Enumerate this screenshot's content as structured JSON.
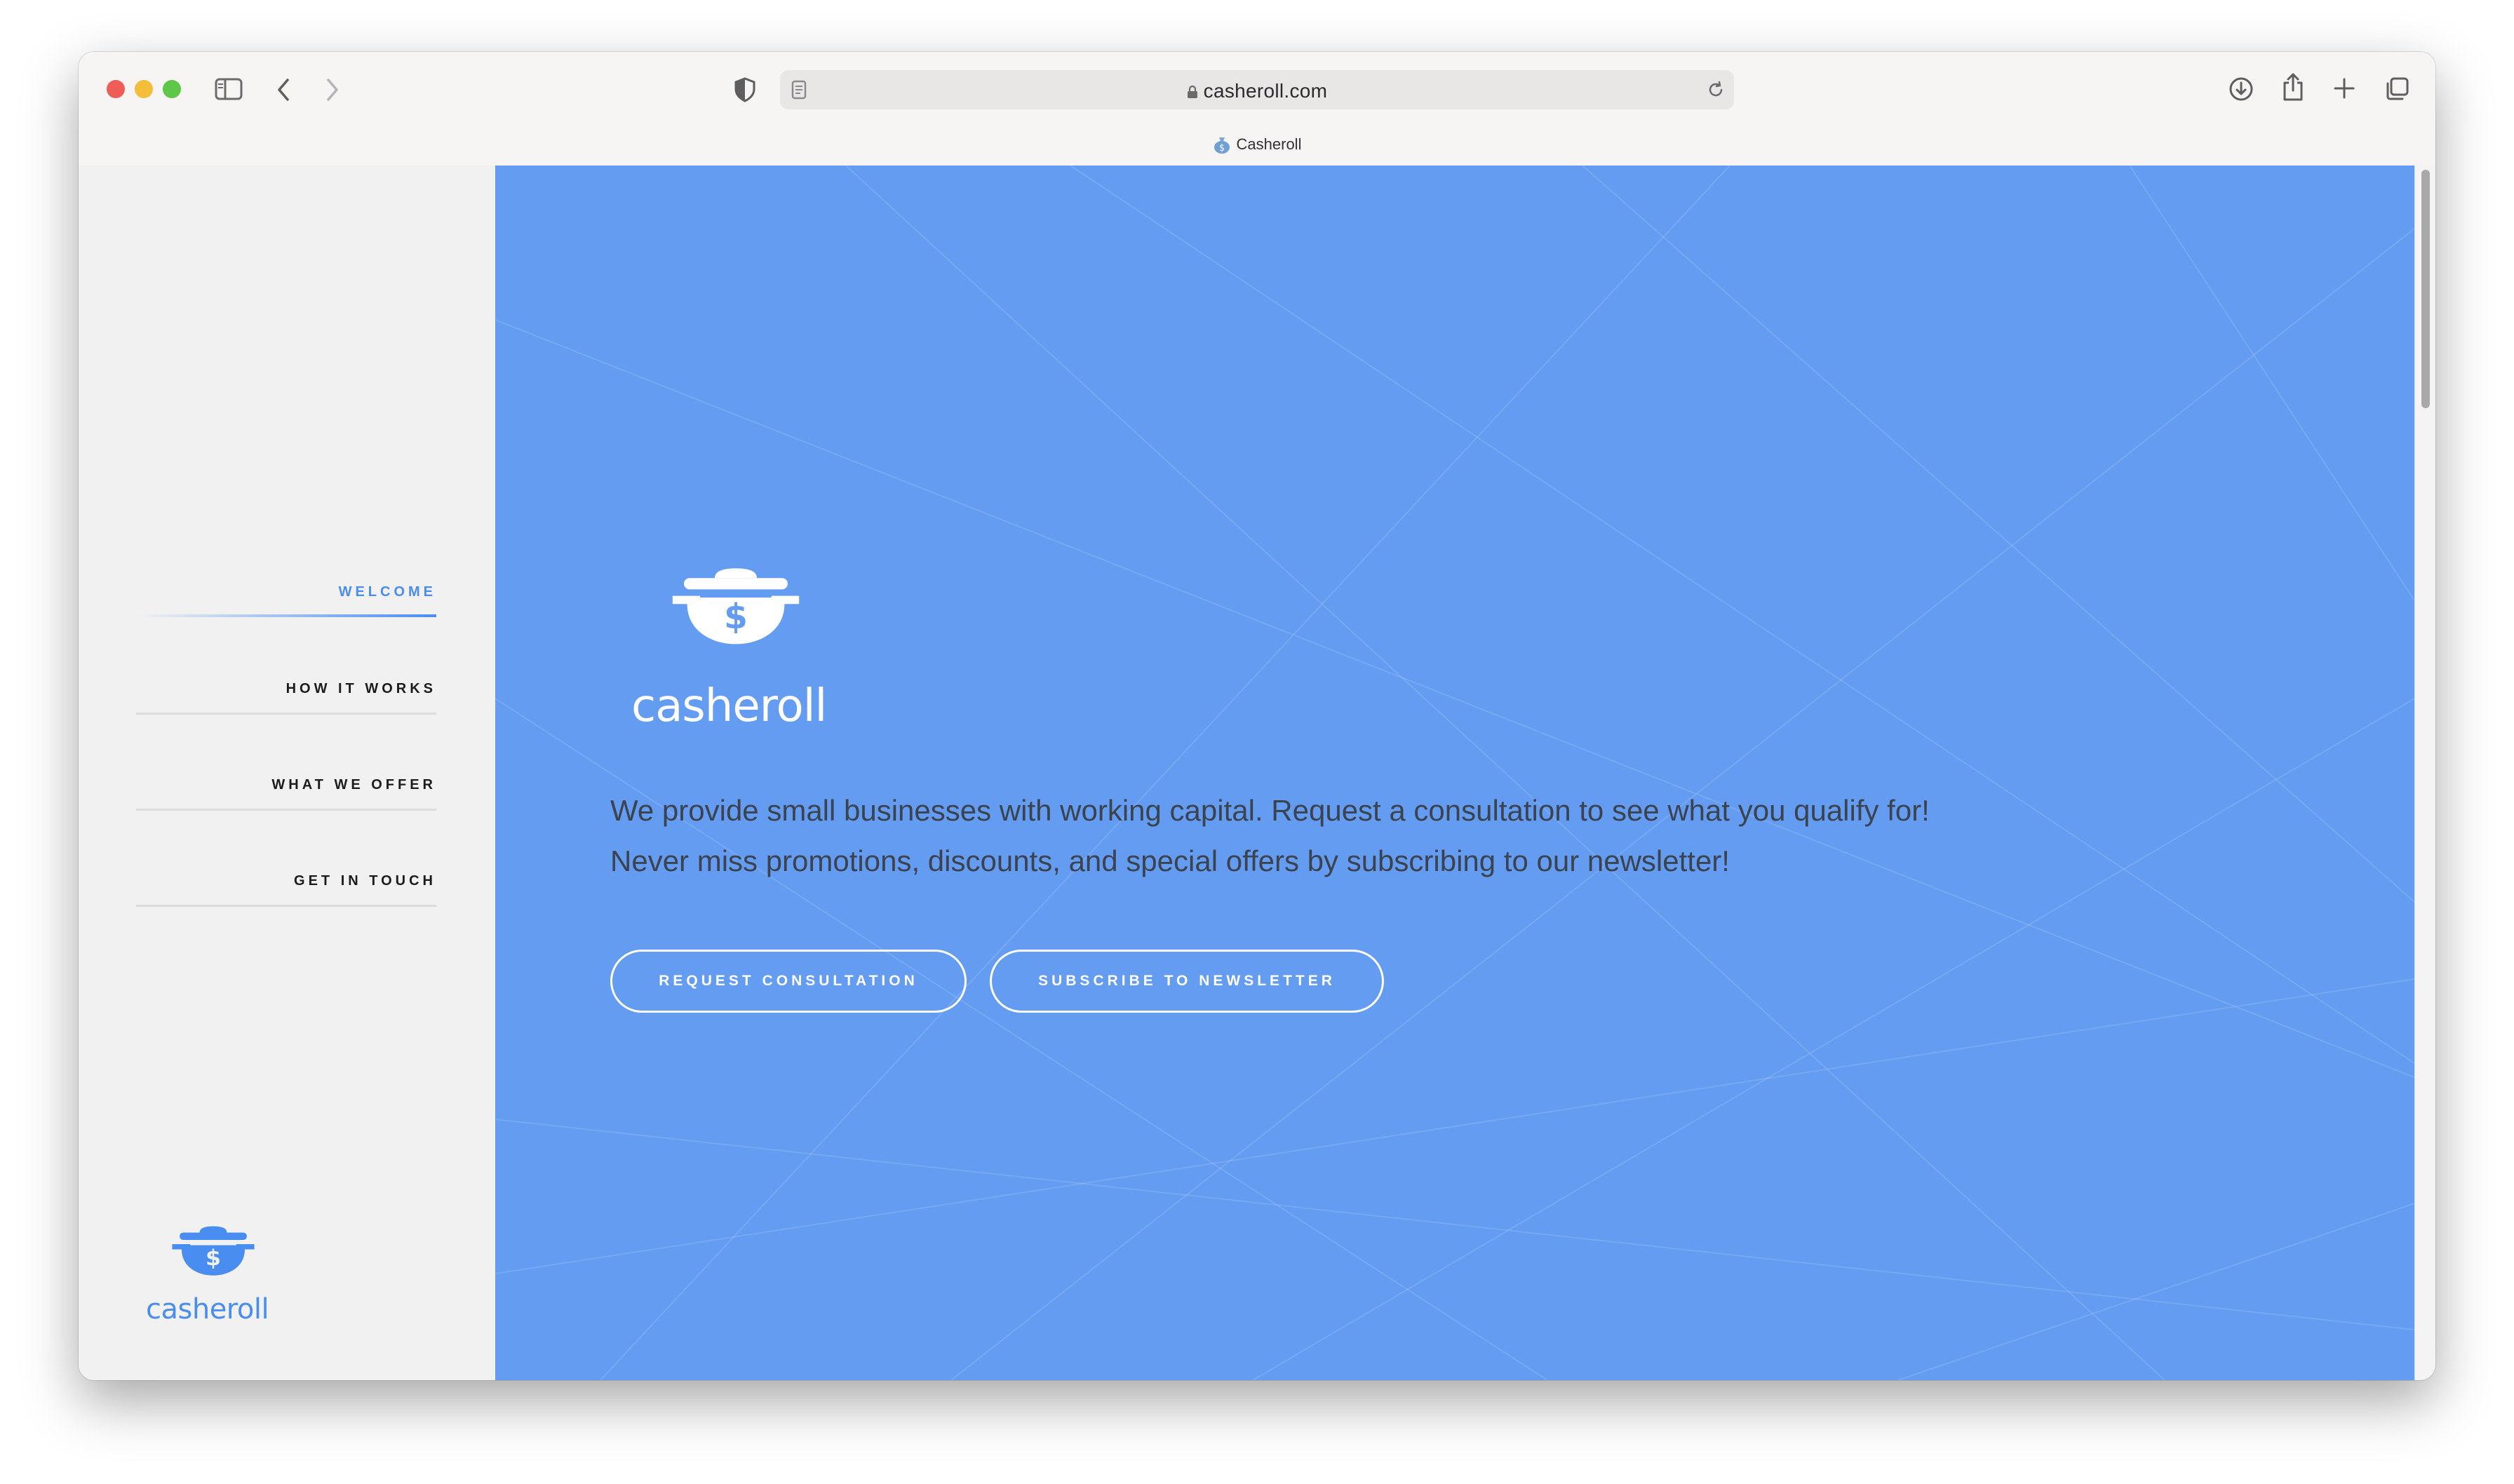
{
  "browser": {
    "url": "casheroll.com",
    "tab_title": "Casheroll"
  },
  "sidebar": {
    "nav": [
      {
        "label": "WELCOME",
        "active": true
      },
      {
        "label": "HOW IT WORKS",
        "active": false
      },
      {
        "label": "WHAT WE OFFER",
        "active": false
      },
      {
        "label": "GET IN TOUCH",
        "active": false
      }
    ],
    "logo_text": "casheroll"
  },
  "hero": {
    "logo_text": "casheroll",
    "line1": "We provide small businesses with working capital. Request a consultation to see what you qualify for!",
    "line2": "Never miss promotions, discounts, and special offers by subscribing to our newsletter!",
    "buttons": {
      "consultation": "REQUEST CONSULTATION",
      "newsletter": "SUBSCRIBE TO NEWSLETTER"
    }
  },
  "colors": {
    "accent": "#4a8df0",
    "hero_background": "#639cf0",
    "sidebar_background": "#f1f1f1"
  }
}
